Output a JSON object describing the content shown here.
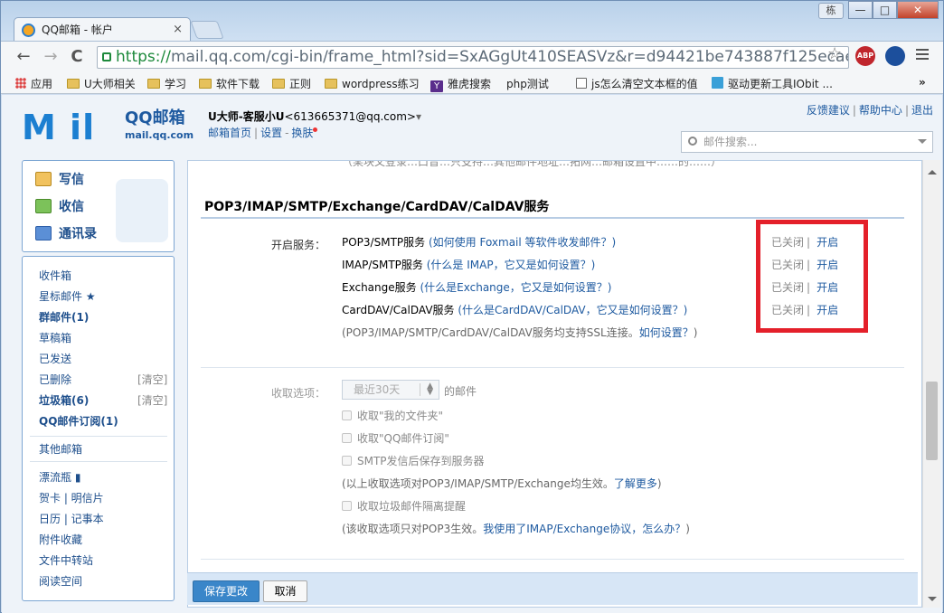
{
  "window": {
    "tab_title": "QQ邮箱 - 帐户",
    "tab_close": "×",
    "user_badge": "栋",
    "controls": {
      "minimize": "—",
      "maximize": "□",
      "close": "✕"
    }
  },
  "browser": {
    "url_scheme": "https://",
    "url_rest": "mail.qq.com/cgi-bin/frame_html?sid=SxAGgUt410SEASVz&r=d94421be743887f125ecae5996da",
    "nav": {
      "back": "←",
      "forward": "→",
      "reload": "C"
    },
    "star": "☆",
    "extensions": [
      {
        "name": "ABP",
        "badge": "1",
        "color": "#c0262d"
      },
      {
        "name": "IObit",
        "badge": "1",
        "color": "#1c4f9c"
      }
    ],
    "bookmarks": [
      {
        "label": "应用",
        "icon": "apps-icon"
      },
      {
        "label": "U大师相关",
        "icon": "folder-icon"
      },
      {
        "label": "学习",
        "icon": "folder-icon"
      },
      {
        "label": "软件下载",
        "icon": "folder-icon"
      },
      {
        "label": "正则",
        "icon": "folder-icon"
      },
      {
        "label": "wordpress练习",
        "icon": "folder-icon"
      },
      {
        "label": "雅虎搜索",
        "icon": "yahoo-icon"
      },
      {
        "label": "php测试",
        "icon": "page-icon"
      },
      {
        "label": "js怎么清空文本框的值",
        "icon": "js-icon"
      },
      {
        "label": "驱动更新工具IObit ...",
        "icon": "iobit-icon"
      }
    ],
    "bookmarks_more": "»"
  },
  "header": {
    "logo_text": "M il",
    "brand_cn": "QQ邮箱",
    "brand_domain": "mail.qq.com",
    "user_display": "U大师-客服小U",
    "user_email": "<613665371@qq.com>",
    "user_caret": "▾",
    "links": [
      "邮箱首页",
      "设置",
      "换肤"
    ],
    "top_links": [
      "反馈建议",
      "帮助中心",
      "退出"
    ],
    "search_placeholder": "邮件搜索..."
  },
  "sidebar": {
    "actions": [
      "写信",
      "收信",
      "通讯录"
    ],
    "folders": [
      {
        "label": "收件箱",
        "bold": false
      },
      {
        "label": "星标邮件 ★",
        "bold": false
      },
      {
        "label": "群邮件(1)",
        "bold": true
      },
      {
        "label": "草稿箱",
        "bold": false
      },
      {
        "label": "已发送",
        "bold": false
      },
      {
        "label": "已删除",
        "bold": false,
        "clear": "[清空]"
      },
      {
        "label": "垃圾箱(6)",
        "bold": true,
        "clear": "[清空]"
      },
      {
        "label": "QQ邮件订阅(1)",
        "bold": true
      }
    ],
    "other_mail": "其他邮箱",
    "extras": [
      "漂流瓶 ▮",
      "贺卡 | 明信片",
      "日历 | 记事本",
      "附件收藏",
      "文件中转站",
      "阅读空间"
    ]
  },
  "content": {
    "cutoff_text": "（某块又登录…口音…只支持…其他邮件地址…拓网…邮箱设置中……的……）",
    "section_title": "POP3/IMAP/SMTP/Exchange/CardDAV/CalDAV服务",
    "open_label": "开启服务：",
    "services": [
      {
        "name": "POP3/SMTP服务",
        "help": "(如何使用 Foxmail 等软件收发邮件？)",
        "status": "已关闭",
        "action": "开启"
      },
      {
        "name": "IMAP/SMTP服务",
        "help": "(什么是 IMAP，它又是如何设置？)",
        "status": "已关闭",
        "action": "开启"
      },
      {
        "name": "Exchange服务",
        "help": "(什么是Exchange，它又是如何设置？)",
        "status": "已关闭",
        "action": "开启"
      },
      {
        "name": "CardDAV/CalDAV服务",
        "help": "(什么是CardDAV/CalDAV，它又是如何设置？)",
        "status": "已关闭",
        "action": "开启"
      }
    ],
    "ssl_note": "(POP3/IMAP/SMTP/CardDAV/CalDAV服务均支持SSL连接。",
    "ssl_link": "如何设置？",
    "ssl_end": ")",
    "fetch_label": "收取选项：",
    "fetch_select": "最近30天",
    "fetch_suffix": "的邮件",
    "options": [
      "收取\"我的文件夹\"",
      "收取\"QQ邮件订阅\"",
      "SMTP发信后保存到服务器"
    ],
    "note1": "(以上收取选项对POP3/IMAP/SMTP/Exchange均生效。",
    "note1_link": "了解更多",
    "note1_end": ")",
    "option_spam": "收取垃圾邮件隔离提醒",
    "note2": "(该收取选项只对POP3生效。",
    "note2_link": "我使用了IMAP/Exchange协议，怎么办？",
    "note2_end": ")",
    "save_button": "保存更改",
    "cancel_button": "取消"
  },
  "colors": {
    "highlight_box": "#e4202a",
    "link": "#1e5aa0",
    "primary_button": "#3a86c9"
  }
}
